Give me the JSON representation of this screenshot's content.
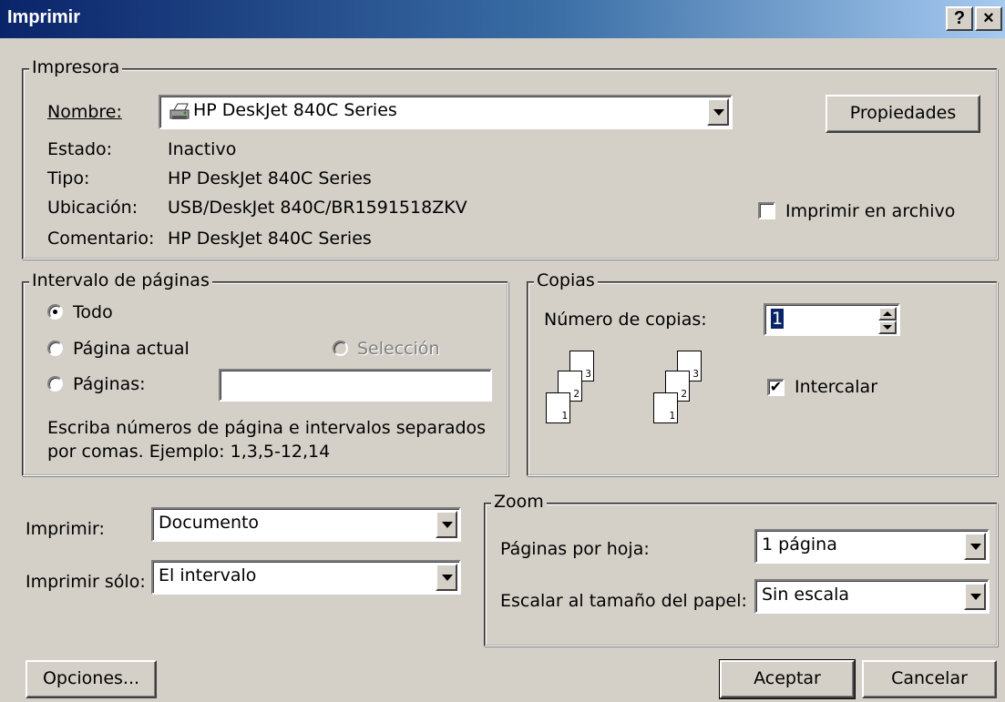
{
  "window": {
    "title": "Imprimir",
    "help_label": "?",
    "close_label": "×"
  },
  "printer": {
    "group_label": "Impresora",
    "name_label": "Nombre:",
    "name_value": "HP DeskJet 840C Series",
    "properties_label": "Propiedades",
    "status_label": "Estado:",
    "status_value": "Inactivo",
    "type_label": "Tipo:",
    "type_value": "HP DeskJet 840C Series",
    "location_label": "Ubicación:",
    "location_value": "USB/DeskJet 840C/BR1591518ZKV",
    "comment_label": "Comentario:",
    "comment_value": "HP DeskJet 840C Series",
    "print_to_file_label": "Imprimir en archivo",
    "print_to_file_checked": false
  },
  "page_range": {
    "group_label": "Intervalo de páginas",
    "all_label": "Todo",
    "current_label": "Página actual",
    "selection_label": "Selección",
    "pages_label": "Páginas:",
    "pages_value": "",
    "hint": "Escriba números de página e intervalos separados por comas. Ejemplo: 1,3,5-12,14",
    "selected": "all"
  },
  "copies": {
    "group_label": "Copias",
    "count_label": "Número de copias:",
    "count_value": "1",
    "collate_label": "Intercalar",
    "collate_checked": true,
    "page_numbers": [
      "1",
      "2",
      "3"
    ]
  },
  "print_what": {
    "label": "Imprimir:",
    "value": "Documento"
  },
  "print_only": {
    "label": "Imprimir sólo:",
    "value": "El intervalo"
  },
  "zoom": {
    "group_label": "Zoom",
    "pages_per_sheet_label": "Páginas por hoja:",
    "pages_per_sheet_value": "1 página",
    "scale_label": "Escalar al tamaño del papel:",
    "scale_value": "Sin escala"
  },
  "footer": {
    "options_label": "Opciones...",
    "ok_label": "Aceptar",
    "cancel_label": "Cancelar"
  }
}
